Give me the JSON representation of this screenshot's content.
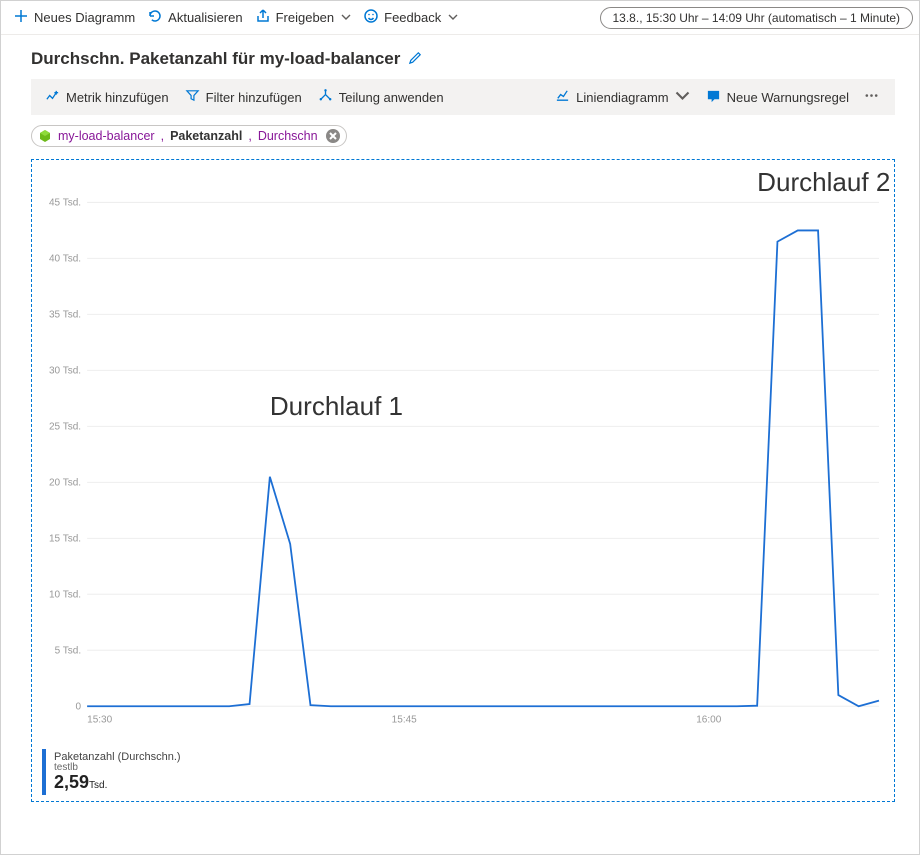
{
  "cmd": {
    "new_chart": "Neues Diagramm",
    "refresh": "Aktualisieren",
    "share": "Freigeben",
    "feedback": "Feedback"
  },
  "time_range_label": "13.8., 15:30 Uhr – 14:09 Uhr (automatisch – 1 Minute)",
  "title": "Durchschn. Paketanzahl für my-load-balancer",
  "toolbar": {
    "add_metric": "Metrik hinzufügen",
    "add_filter": "Filter hinzufügen",
    "apply_splitting": "Teilung anwenden",
    "chart_type": "Liniendiagramm",
    "new_alert": "Neue Warnungsregel"
  },
  "chip": {
    "resource": "my-load-balancer",
    "metric": "Paketanzahl",
    "aggregation": "Durchschn"
  },
  "legend": {
    "line1": "Paketanzahl (Durchschn.)",
    "line2": "testlb",
    "value": "2,59",
    "unit": "Tsd."
  },
  "annotations": {
    "run1": "Durchlauf 1",
    "run2": "Durchlauf 2"
  },
  "chart_data": {
    "type": "line",
    "xlabel": "",
    "ylabel": "",
    "ylim": [
      0,
      47000
    ],
    "y_ticks": [
      0,
      5000,
      10000,
      15000,
      20000,
      25000,
      30000,
      35000,
      40000,
      45000
    ],
    "y_tick_labels": [
      "0",
      "5 Tsd.",
      "10 Tsd.",
      "15 Tsd.",
      "20 Tsd.",
      "25 Tsd.",
      "30 Tsd.",
      "35 Tsd.",
      "40 Tsd.",
      "45 Tsd."
    ],
    "x_ticks": [
      "15:30",
      "15:45",
      "16:00"
    ],
    "annotations": [
      {
        "label_key": "run1",
        "x": 9,
        "y": 26000
      },
      {
        "label_key": "run2",
        "x": 33,
        "y": 46000
      }
    ],
    "series": [
      {
        "name": "Paketanzahl (Durchschn.)",
        "color": "#1d6fd4",
        "x": [
          0,
          1,
          2,
          3,
          4,
          5,
          6,
          7,
          8,
          9,
          10,
          11,
          12,
          13,
          14,
          15,
          16,
          17,
          18,
          19,
          20,
          21,
          22,
          23,
          24,
          25,
          26,
          27,
          28,
          29,
          30,
          31,
          32,
          33,
          34,
          35,
          36,
          37,
          38,
          39
        ],
        "values": [
          0,
          0,
          0,
          0,
          0,
          0,
          0,
          0,
          200,
          20500,
          14500,
          100,
          0,
          0,
          0,
          0,
          0,
          0,
          0,
          0,
          0,
          0,
          0,
          0,
          0,
          0,
          0,
          0,
          0,
          0,
          0,
          0,
          0,
          50,
          41500,
          42500,
          42500,
          1000,
          0,
          500
        ]
      }
    ]
  }
}
